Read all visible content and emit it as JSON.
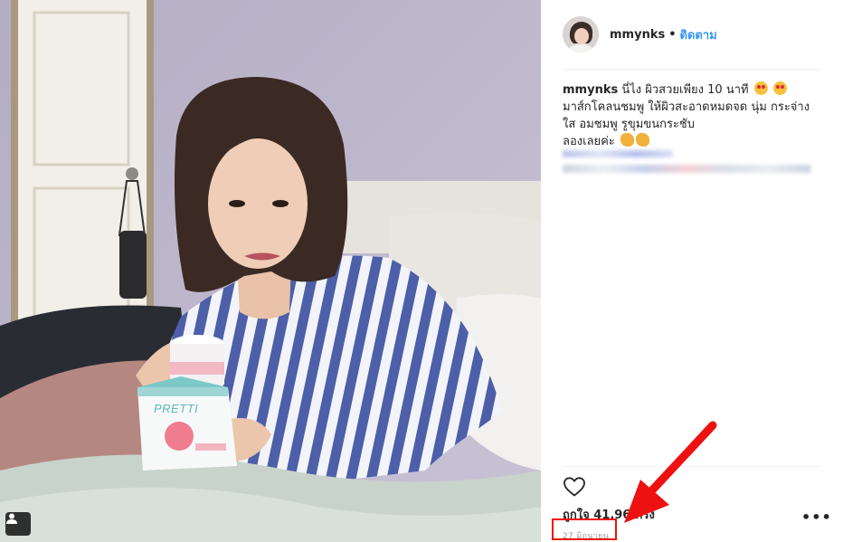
{
  "post": {
    "username": "mmynks",
    "separator": "•",
    "follow_label": "ติดตาม",
    "caption": {
      "username": "mmynks",
      "line1": "นี่ไง ผิวสวยเพียง 10 นาที",
      "line2": "มาส์กโคลนชมพู ให้ผิวสะอาดหมดจด นุ่ม กระจ่าง",
      "line3": "ใส อมชมพู รูขุมขนกระชับ",
      "line4": "ลองเลยค่ะ"
    },
    "likes": "ถูกใจ 41,96   ครั้ง",
    "date": "27 มิถุนายน",
    "more_label": "•••"
  },
  "product": {
    "brand_text": "PRETTI"
  },
  "colors": {
    "follow": "#3897f0",
    "annotation": "#ee1111",
    "divider": "#efefef"
  },
  "icons": [
    "user-tag-icon",
    "heart-icon",
    "more-options-icon",
    "heart-eyes-emoji",
    "clapping-hands-emoji"
  ]
}
